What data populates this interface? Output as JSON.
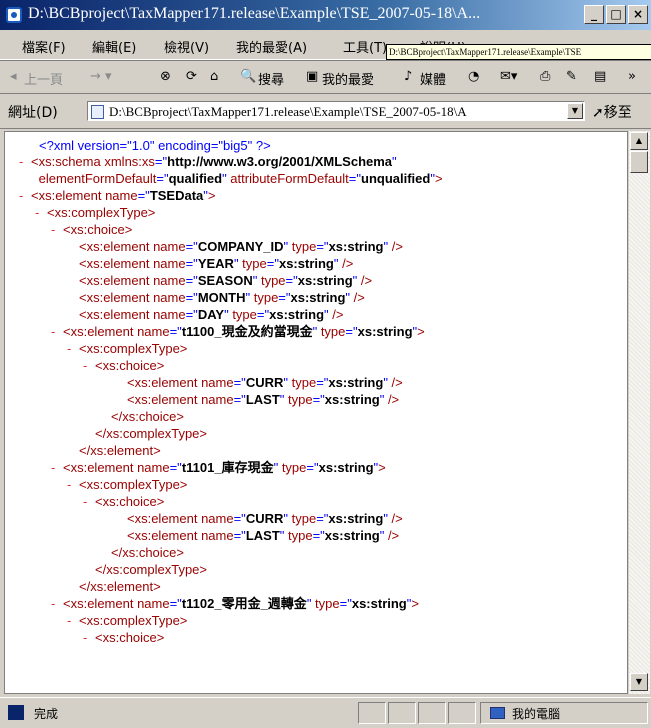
{
  "window": {
    "title": "D:\\BCBproject\\TaxMapper171.release\\Example\\TSE_2007-05-18\\A..."
  },
  "menu": [
    "檔案(F)",
    "編輯(E)",
    "檢視(V)",
    "我的最愛(A)",
    "工具(T)",
    "說明(H)"
  ],
  "tooltip": "D:\\BCBproject\\TaxMapper171.release\\Example\\TSE",
  "toolbar": {
    "back": "上一頁",
    "search": "搜尋",
    "favorites": "我的最愛",
    "media": "媒體"
  },
  "address": {
    "label": "網址(D)",
    "value": "D:\\BCBproject\\TaxMapper171.release\\Example\\TSE_2007-05-18\\A",
    "go": "移至"
  },
  "xml": {
    "decl": "<?xml version=\"1.0\" encoding=\"big5\" ?>",
    "lines": [
      {
        "m": "-",
        "open": "<xs:schema",
        "attrs": [
          {
            "n": "xmlns:xs",
            "v": "http://www.w3.org/2001/XMLSchema"
          }
        ],
        "close": ""
      },
      {
        "m": "",
        "open": "",
        "attrs": [
          {
            "n": "elementFormDefault",
            "v": "qualified"
          },
          {
            "n": "attributeFormDefault",
            "v": "unqualified"
          }
        ],
        "close": ">"
      },
      {
        "m": "-",
        "open": "<xs:element",
        "attrs": [
          {
            "n": "name",
            "v": "TSEData"
          }
        ],
        "close": ">"
      },
      {
        "m": "-",
        "open": "<xs:complexType>",
        "attrs": [],
        "close": ""
      },
      {
        "m": "-",
        "open": "<xs:choice>",
        "attrs": [],
        "close": ""
      },
      {
        "m": "",
        "open": "<xs:element",
        "attrs": [
          {
            "n": "name",
            "v": "COMPANY_ID"
          },
          {
            "n": "type",
            "v": "xs:string"
          }
        ],
        "close": "/>"
      },
      {
        "m": "",
        "open": "<xs:element",
        "attrs": [
          {
            "n": "name",
            "v": "YEAR"
          },
          {
            "n": "type",
            "v": "xs:string"
          }
        ],
        "close": "/>"
      },
      {
        "m": "",
        "open": "<xs:element",
        "attrs": [
          {
            "n": "name",
            "v": "SEASON"
          },
          {
            "n": "type",
            "v": "xs:string"
          }
        ],
        "close": "/>"
      },
      {
        "m": "",
        "open": "<xs:element",
        "attrs": [
          {
            "n": "name",
            "v": "MONTH"
          },
          {
            "n": "type",
            "v": "xs:string"
          }
        ],
        "close": "/>"
      },
      {
        "m": "",
        "open": "<xs:element",
        "attrs": [
          {
            "n": "name",
            "v": "DAY"
          },
          {
            "n": "type",
            "v": "xs:string"
          }
        ],
        "close": "/>"
      },
      {
        "m": "-",
        "open": "<xs:element",
        "attrs": [
          {
            "n": "name",
            "v": "t1100_現金及約當現金"
          },
          {
            "n": "type",
            "v": "xs:string"
          }
        ],
        "close": ">"
      },
      {
        "m": "-",
        "open": "<xs:complexType>",
        "attrs": [],
        "close": ""
      },
      {
        "m": "-",
        "open": "<xs:choice>",
        "attrs": [],
        "close": ""
      },
      {
        "m": "",
        "open": "<xs:element",
        "attrs": [
          {
            "n": "name",
            "v": "CURR"
          },
          {
            "n": "type",
            "v": "xs:string"
          }
        ],
        "close": "/>"
      },
      {
        "m": "",
        "open": "<xs:element",
        "attrs": [
          {
            "n": "name",
            "v": "LAST"
          },
          {
            "n": "type",
            "v": "xs:string"
          }
        ],
        "close": "/>"
      },
      {
        "m": "",
        "open": "</xs:choice>",
        "attrs": [],
        "close": ""
      },
      {
        "m": "",
        "open": "</xs:complexType>",
        "attrs": [],
        "close": ""
      },
      {
        "m": "",
        "open": "</xs:element>",
        "attrs": [],
        "close": ""
      },
      {
        "m": "-",
        "open": "<xs:element",
        "attrs": [
          {
            "n": "name",
            "v": "t1101_庫存現金"
          },
          {
            "n": "type",
            "v": "xs:string"
          }
        ],
        "close": ">"
      },
      {
        "m": "-",
        "open": "<xs:complexType>",
        "attrs": [],
        "close": ""
      },
      {
        "m": "-",
        "open": "<xs:choice>",
        "attrs": [],
        "close": ""
      },
      {
        "m": "",
        "open": "<xs:element",
        "attrs": [
          {
            "n": "name",
            "v": "CURR"
          },
          {
            "n": "type",
            "v": "xs:string"
          }
        ],
        "close": "/>"
      },
      {
        "m": "",
        "open": "<xs:element",
        "attrs": [
          {
            "n": "name",
            "v": "LAST"
          },
          {
            "n": "type",
            "v": "xs:string"
          }
        ],
        "close": "/>"
      },
      {
        "m": "",
        "open": "</xs:choice>",
        "attrs": [],
        "close": ""
      },
      {
        "m": "",
        "open": "</xs:complexType>",
        "attrs": [],
        "close": ""
      },
      {
        "m": "",
        "open": "</xs:element>",
        "attrs": [],
        "close": ""
      },
      {
        "m": "-",
        "open": "<xs:element",
        "attrs": [
          {
            "n": "name",
            "v": "t1102_零用金_週轉金"
          },
          {
            "n": "type",
            "v": "xs:string"
          }
        ],
        "close": ">"
      },
      {
        "m": "-",
        "open": "<xs:complexType>",
        "attrs": [],
        "close": ""
      },
      {
        "m": "-",
        "open": "<xs:choice>",
        "attrs": [],
        "close": ""
      }
    ]
  },
  "status": {
    "text": "完成",
    "zone": "我的電腦"
  }
}
